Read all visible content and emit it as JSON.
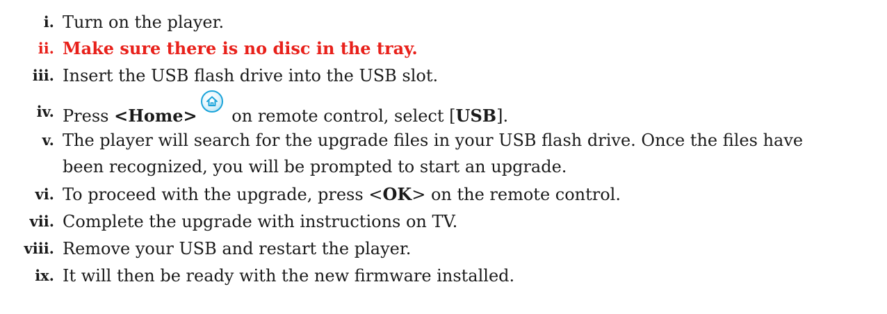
{
  "steps": [
    {
      "num": "i.",
      "text": "Turn on the player."
    },
    {
      "num": "ii.",
      "text": "Make sure there is no disc in the tray.",
      "emphasis_color": "#e8211b"
    },
    {
      "num": "iii.",
      "text": "Insert the USB flash drive into the USB slot."
    },
    {
      "num": "iv.",
      "pre": "Press ",
      "key": "<Home>",
      "post": " on remote control, select [",
      "option": "USB",
      "end": "].",
      "icon": "home-icon"
    },
    {
      "num": "v.",
      "line1": "The player will search for the upgrade files in your USB flash drive. Once the files have",
      "line2": "been recognized, you will be prompted to start an upgrade."
    },
    {
      "num": "vi.",
      "pre": "To proceed with the upgrade, press <",
      "key": "OK",
      "post": "> on the remote control."
    },
    {
      "num": "vii.",
      "text": "Complete the upgrade with instructions on TV."
    },
    {
      "num": "viii.",
      "text": "Remove your USB and restart the player."
    },
    {
      "num": "ix.",
      "text": "It will then be ready with the new firmware installed."
    }
  ],
  "colors": {
    "text": "#1a1a1a",
    "warning": "#e8211b",
    "icon_accent": "#1aa3d9"
  }
}
